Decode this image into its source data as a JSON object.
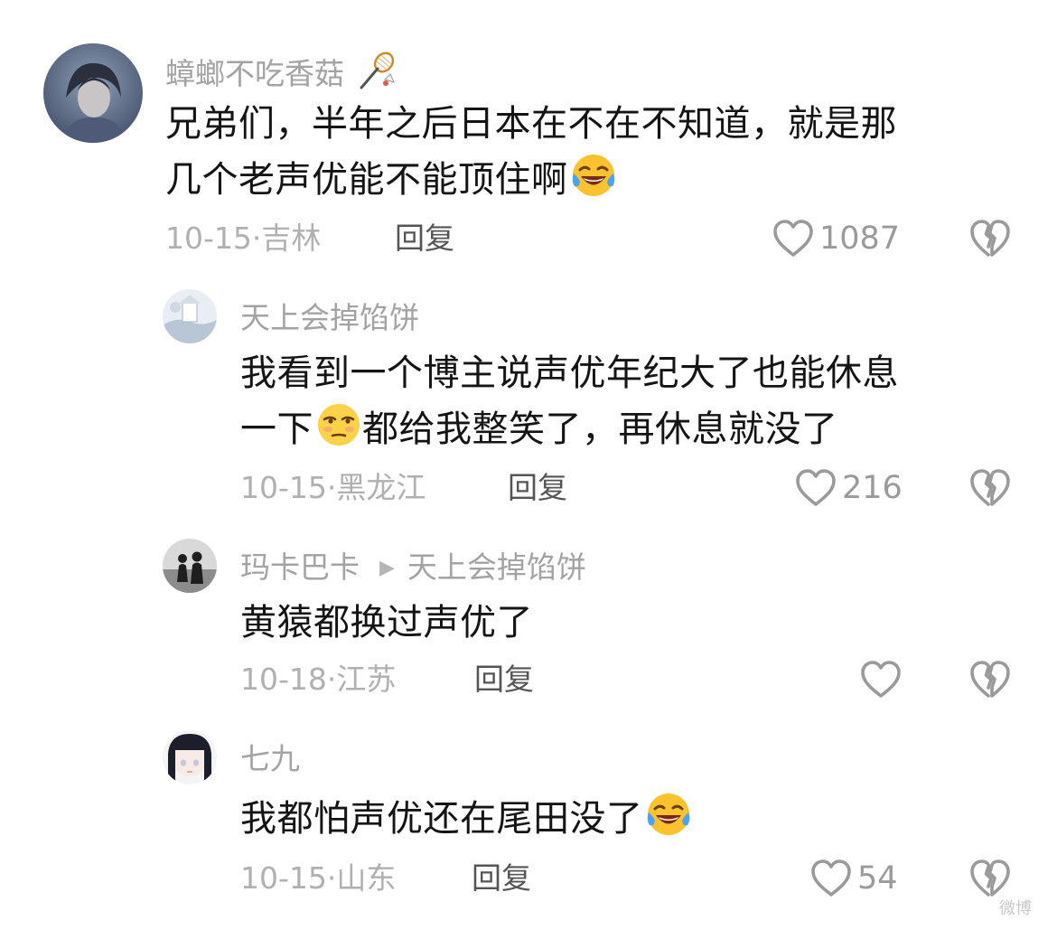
{
  "comments": [
    {
      "username": "蟑螂不吃香菇",
      "badge_icon": "badminton-icon",
      "text_line1": "兄弟们，半年之后日本在不在不知道，就是那",
      "text_line2": "几个老声优能不能顶住啊",
      "emoji": "laugh-cry-emoji",
      "date": "10-15·吉林",
      "reply_label": "回复",
      "likes": "1087"
    },
    {
      "username": "天上会掉馅饼",
      "text_line1": "我看到一个博主说声优年纪大了也能休息",
      "text_line2_pre": "一下",
      "text_line2_post": "都给我整笑了，再休息就没了",
      "emoji": "relieved-emoji",
      "date": "10-15·黑龙江",
      "reply_label": "回复",
      "likes": "216"
    },
    {
      "username": "玛卡巴卡",
      "reply_to": "天上会掉馅饼",
      "text_line1": "黄猿都换过声优了",
      "date": "10-18·江苏",
      "reply_label": "回复",
      "likes": ""
    },
    {
      "username": "七九",
      "text_line1": "我都怕声优还在尾田没了",
      "emoji": "laugh-cry-emoji",
      "date": "10-15·山东",
      "reply_label": "回复",
      "likes": "54"
    }
  ],
  "watermark": "微博"
}
